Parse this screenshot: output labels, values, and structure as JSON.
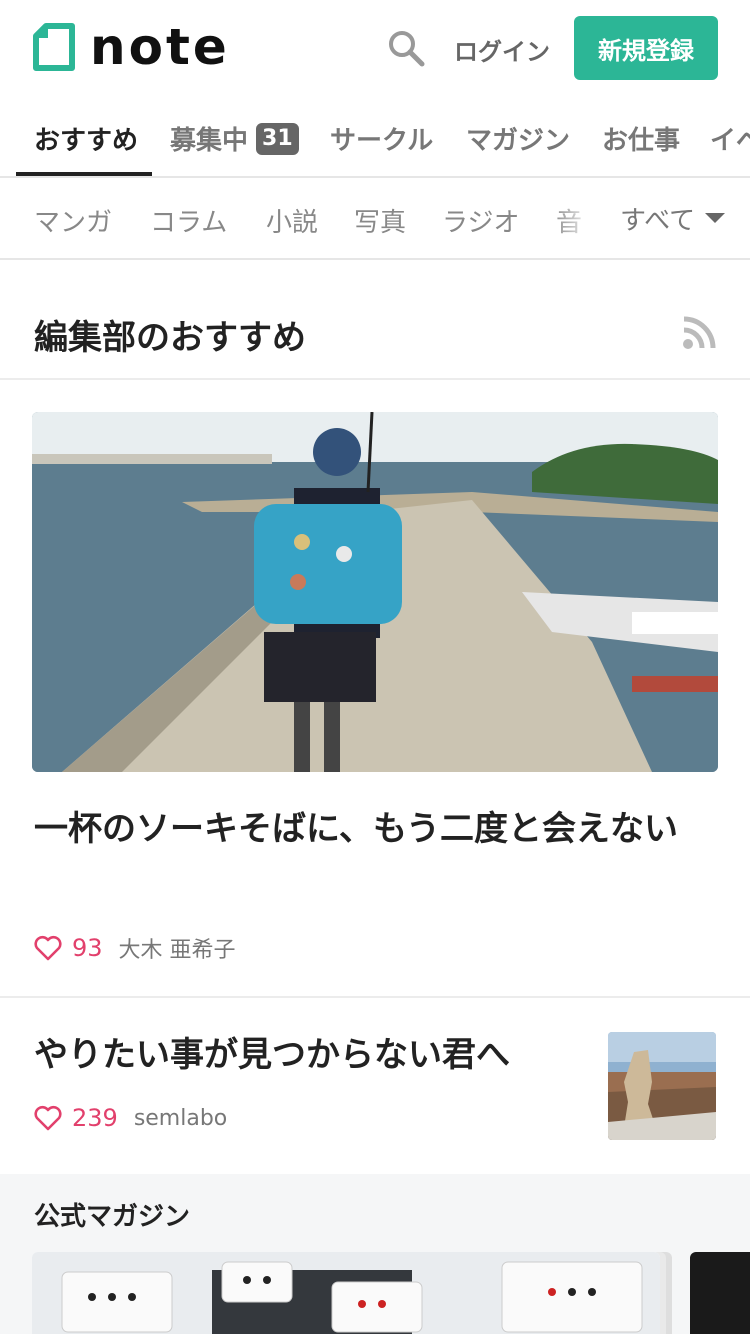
{
  "header": {
    "logo_text": "note",
    "login_label": "ログイン",
    "signup_label": "新規登録"
  },
  "tabs": [
    {
      "label": "おすすめ",
      "active": true
    },
    {
      "label": "募集中",
      "badge": "31"
    },
    {
      "label": "サークル"
    },
    {
      "label": "マガジン"
    },
    {
      "label": "お仕事"
    },
    {
      "label": "イベ"
    }
  ],
  "categories": [
    "マンガ",
    "コラム",
    "小説",
    "写真",
    "ラジオ",
    "音"
  ],
  "categories_all_label": "すべて",
  "section": {
    "title": "編集部のおすすめ"
  },
  "featured": {
    "title": "一杯のソーキそばに、もう二度と会えない",
    "likes": "93",
    "author": "大木 亜希子"
  },
  "article2": {
    "title": "やりたい事が見つからない君へ",
    "likes": "239",
    "author": "semlabo"
  },
  "magazines": {
    "title": "公式マガジン"
  },
  "colors": {
    "brand": "#2cb696",
    "like": "#e2406c"
  },
  "icons": [
    "note-logo-icon",
    "search-icon",
    "rss-icon",
    "heart-icon",
    "chevron-down-icon"
  ]
}
